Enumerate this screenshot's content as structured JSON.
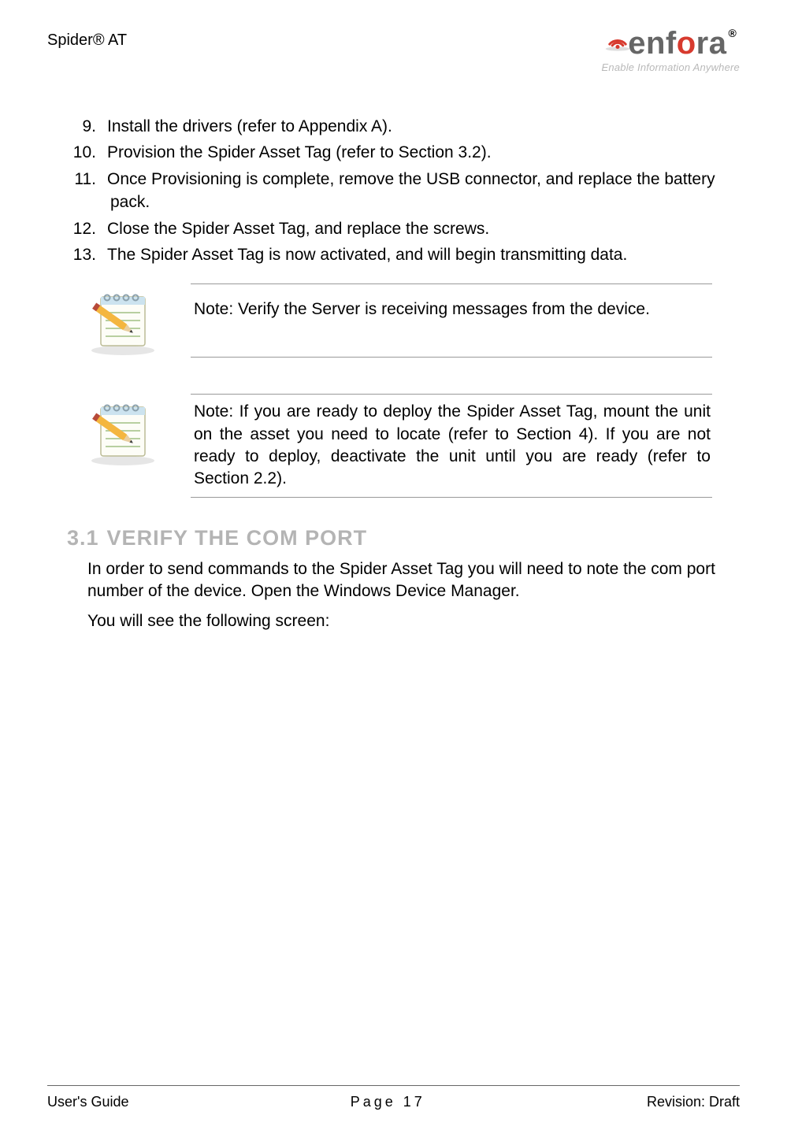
{
  "header": {
    "product": "Spider® AT",
    "logo_e": "e",
    "logo_n": "n",
    "logo_f": "f",
    "logo_o": "o",
    "logo_r": "r",
    "logo_a": "a",
    "reg": "®",
    "tagline": "Enable Information Anywhere"
  },
  "list": {
    "items": [
      {
        "num": "9.",
        "text": "Install the drivers (refer to Appendix A)."
      },
      {
        "num": "10.",
        "text": "Provision the Spider Asset Tag (refer to Section 3.2)."
      },
      {
        "num": "11.",
        "text": "Once Provisioning is complete, remove the USB connector, and replace the battery pack."
      },
      {
        "num": "12.",
        "text": "Close the Spider Asset Tag, and replace the screws."
      },
      {
        "num": "13.",
        "text": "The Spider Asset Tag is now activated, and will begin transmitting data."
      }
    ]
  },
  "notes": {
    "n1": "Note: Verify the Server is receiving messages from the device.",
    "n2": "Note: If you are ready to deploy the Spider Asset Tag, mount the unit on the asset you need to locate (refer to Section 4). If you are not ready to deploy, deactivate the unit until you are ready (refer to Section 2.2)."
  },
  "section": {
    "num": "3.1",
    "title": "VERIFY THE COM PORT",
    "p1": "In order to send commands to the Spider Asset Tag you will need to note the com port number of the device. Open the Windows Device Manager.",
    "p2": "You will see the following screen:"
  },
  "footer": {
    "left": "User's Guide",
    "center": "Page 17",
    "right": "Revision: Draft"
  }
}
